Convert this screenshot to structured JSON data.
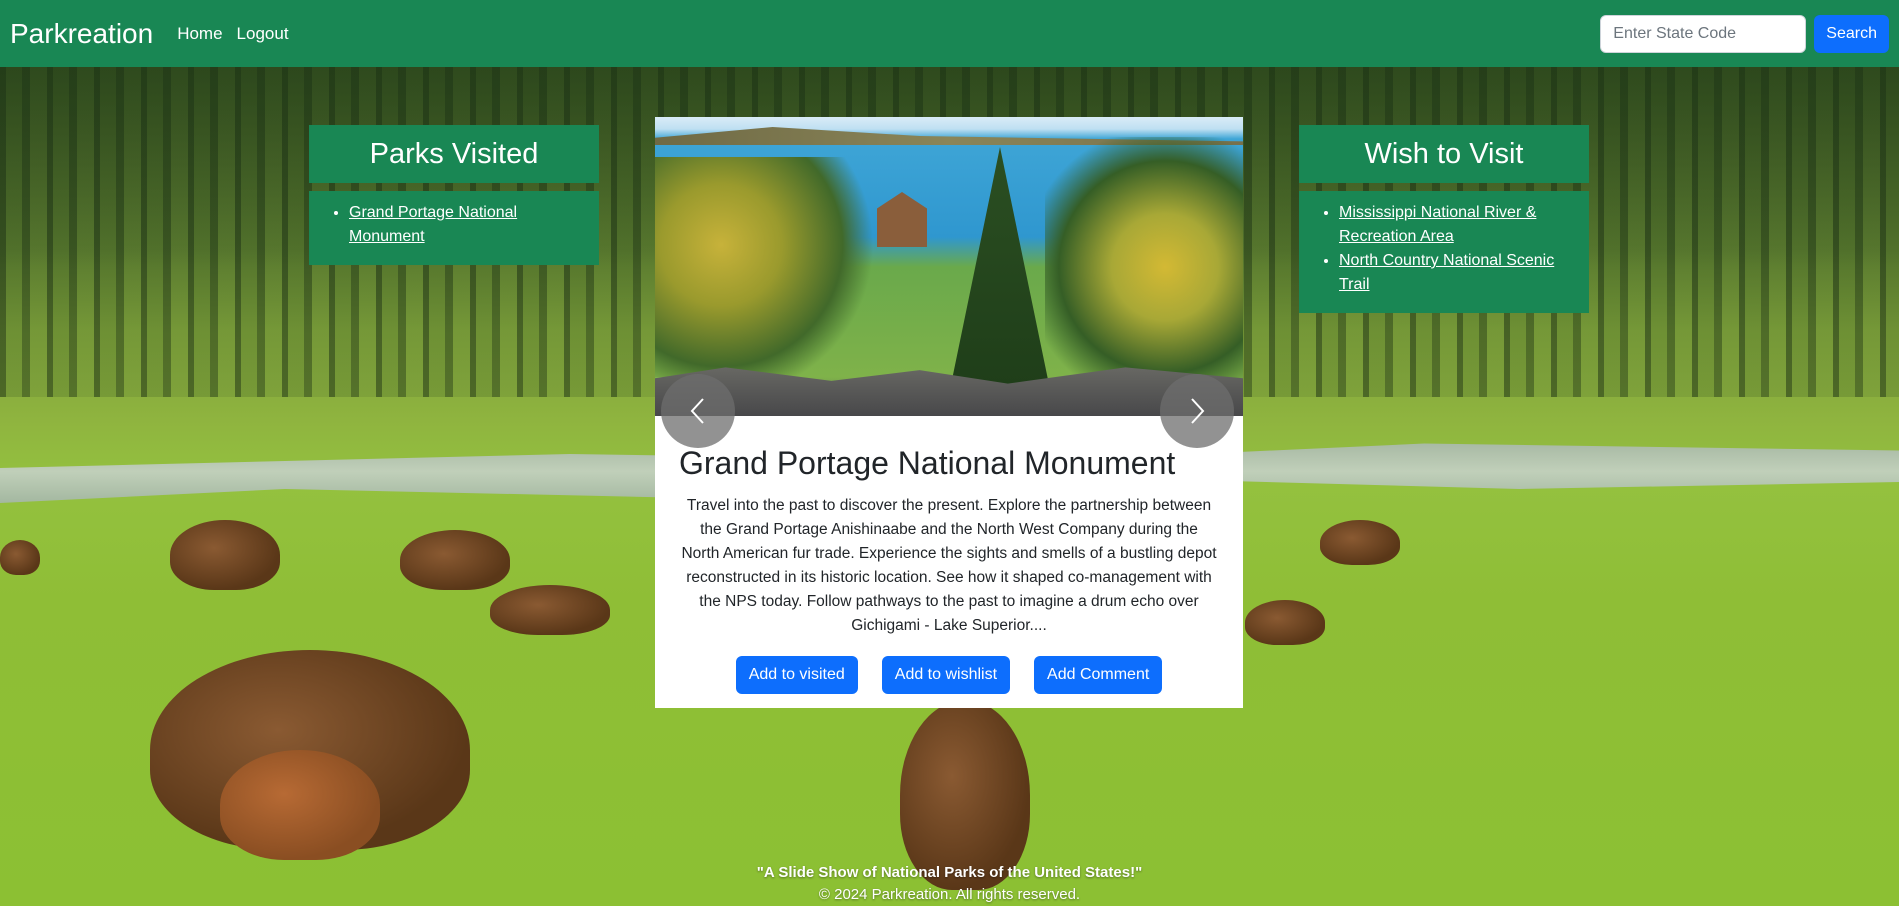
{
  "navbar": {
    "brand": "Parkreation",
    "links": [
      "Home",
      "Logout"
    ],
    "search_placeholder": "Enter State Code",
    "search_button": "Search",
    "color": "#198754"
  },
  "visited": {
    "title": "Parks Visited",
    "items": [
      "Grand Portage National Monument"
    ]
  },
  "wishlist": {
    "title": "Wish to Visit",
    "items": [
      "Mississippi National River & Recreation Area",
      "North Country National Scenic Trail"
    ]
  },
  "card": {
    "title": "Grand Portage National Monument",
    "description": "Travel into the past to discover the present. Explore the partnership between the Grand Portage Anishinaabe and the North West Company during the North American fur trade. Experience the sights and smells of a bustling depot reconstructed in its historic location. See how it shaped co-management with the NPS today. Follow pathways to the past to imagine a drum echo over Gichigami - Lake Superior....",
    "actions": [
      "Add to visited",
      "Add to wishlist",
      "Add Comment"
    ],
    "button_color": "#0d6efd"
  },
  "footer": {
    "tagline": "\"A Slide Show of National Parks of the United States!\"",
    "copyright": "© 2024 Parkreation. All rights reserved."
  }
}
